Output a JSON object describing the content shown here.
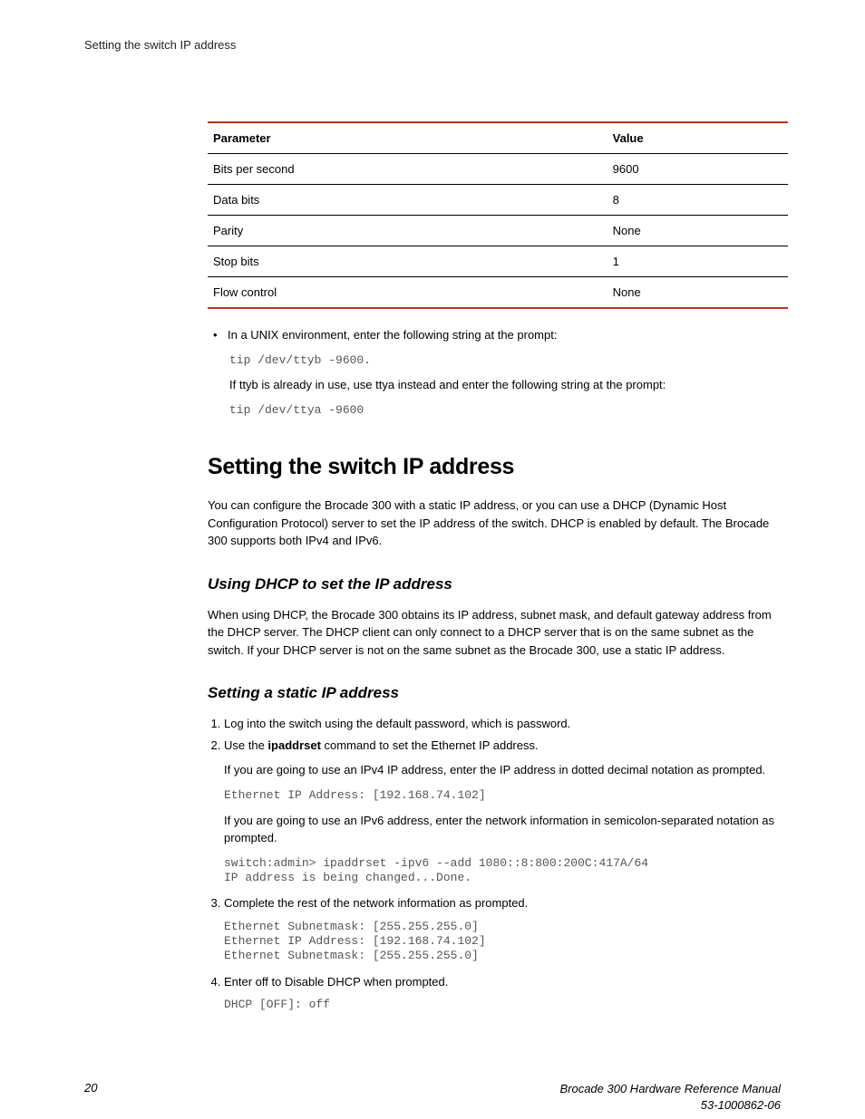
{
  "running_header": "Setting the switch IP address",
  "table": {
    "headers": {
      "c0": "Parameter",
      "c1": "Value"
    },
    "rows": [
      {
        "c0": "Bits per second",
        "c1": "9600"
      },
      {
        "c0": "Data bits",
        "c1": "8"
      },
      {
        "c0": "Parity",
        "c1": "None"
      },
      {
        "c0": "Stop bits",
        "c1": "1"
      },
      {
        "c0": "Flow control",
        "c1": "None"
      }
    ]
  },
  "unix_bullet": "In a UNIX environment, enter the following string at the prompt:",
  "code_ttyb": "tip /dev/ttyb -9600.",
  "ttyb_note": "If ttyb is already in use, use ttya instead and enter the following string at the prompt:",
  "code_ttya": "tip /dev/ttya -9600",
  "h1": "Setting the switch IP address",
  "intro": "You can configure the Brocade 300 with a static IP address, or you can use a DHCP (Dynamic Host Configuration Protocol) server to set the IP address of the switch. DHCP is enabled by default. The Brocade 300 supports both IPv4 and IPv6.",
  "h2_dhcp": "Using DHCP to set the IP address",
  "dhcp_body": "When using DHCP, the Brocade 300 obtains its IP address, subnet mask, and default gateway address from the DHCP server. The DHCP client can only connect to a DHCP server that is on the same subnet as the switch. If your DHCP server is not on the same subnet as the Brocade 300, use a static IP address.",
  "h2_static": "Setting a static IP address",
  "steps": {
    "s1": "Log into the switch using the default password, which is password.",
    "s2_pre": "Use the ",
    "s2_cmd": "ipaddrset",
    "s2_post": " command to set the Ethernet IP address.",
    "s2_ipv4": "If you are going to use an IPv4 IP address, enter the IP address in dotted decimal notation as prompted.",
    "s2_code_ipv4": "Ethernet IP Address: [192.168.74.102]",
    "s2_ipv6": "If you are going to use an IPv6 address, enter the network information in semicolon-separated notation as prompted.",
    "s2_code_ipv6": "switch:admin> ipaddrset -ipv6 --add 1080::8:800:200C:417A/64\nIP address is being changed...Done.",
    "s3": "Complete the rest of the network information as prompted.",
    "s3_code": "Ethernet Subnetmask: [255.255.255.0]\nEthernet IP Address: [192.168.74.102]\nEthernet Subnetmask: [255.255.255.0]",
    "s4": "Enter off to Disable DHCP when prompted.",
    "s4_code": "DHCP [OFF]: off"
  },
  "footer": {
    "page": "20",
    "title": "Brocade 300 Hardware Reference Manual",
    "docnum": "53-1000862-06"
  }
}
